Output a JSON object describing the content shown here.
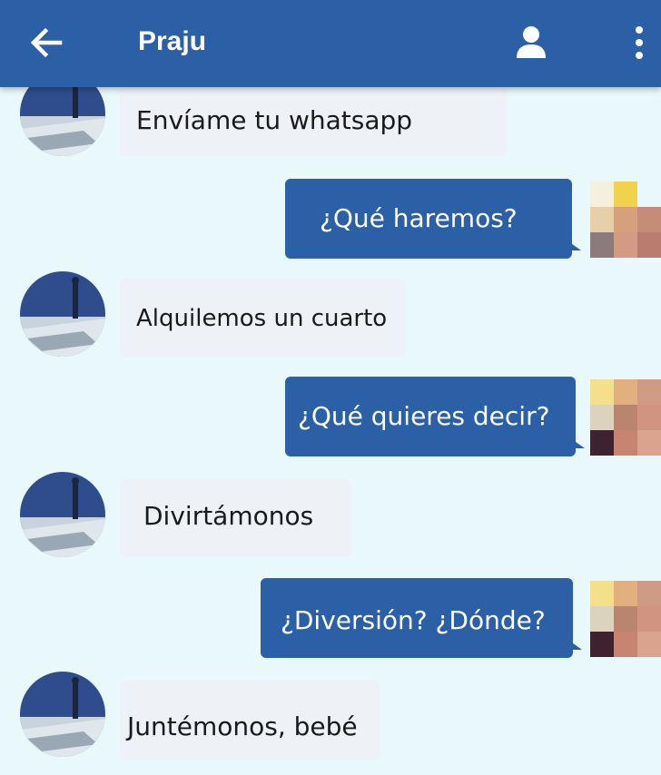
{
  "header": {
    "title": "Praju",
    "back_icon": "arrow-left-icon",
    "profile_icon": "person-icon",
    "menu_icon": "more-vertical-icon",
    "bar_color": "#2b5fa6"
  },
  "messages": [
    {
      "direction": "incoming",
      "text": "Envíame tu whatsapp"
    },
    {
      "direction": "outgoing",
      "text": "¿Qué haremos?"
    },
    {
      "direction": "incoming",
      "text": "Alquilemos un cuarto"
    },
    {
      "direction": "outgoing",
      "text": "¿Qué quieres decir?"
    },
    {
      "direction": "incoming",
      "text": "Divirtámonos"
    },
    {
      "direction": "outgoing",
      "text": "¿Diversión? ¿Dónde?"
    },
    {
      "direction": "incoming",
      "text": "Juntémonos, bebé"
    }
  ],
  "colors": {
    "background": "#e9f9fb",
    "incoming_bubble": "#eef1f5",
    "outgoing_bubble": "#2b5fa6"
  }
}
